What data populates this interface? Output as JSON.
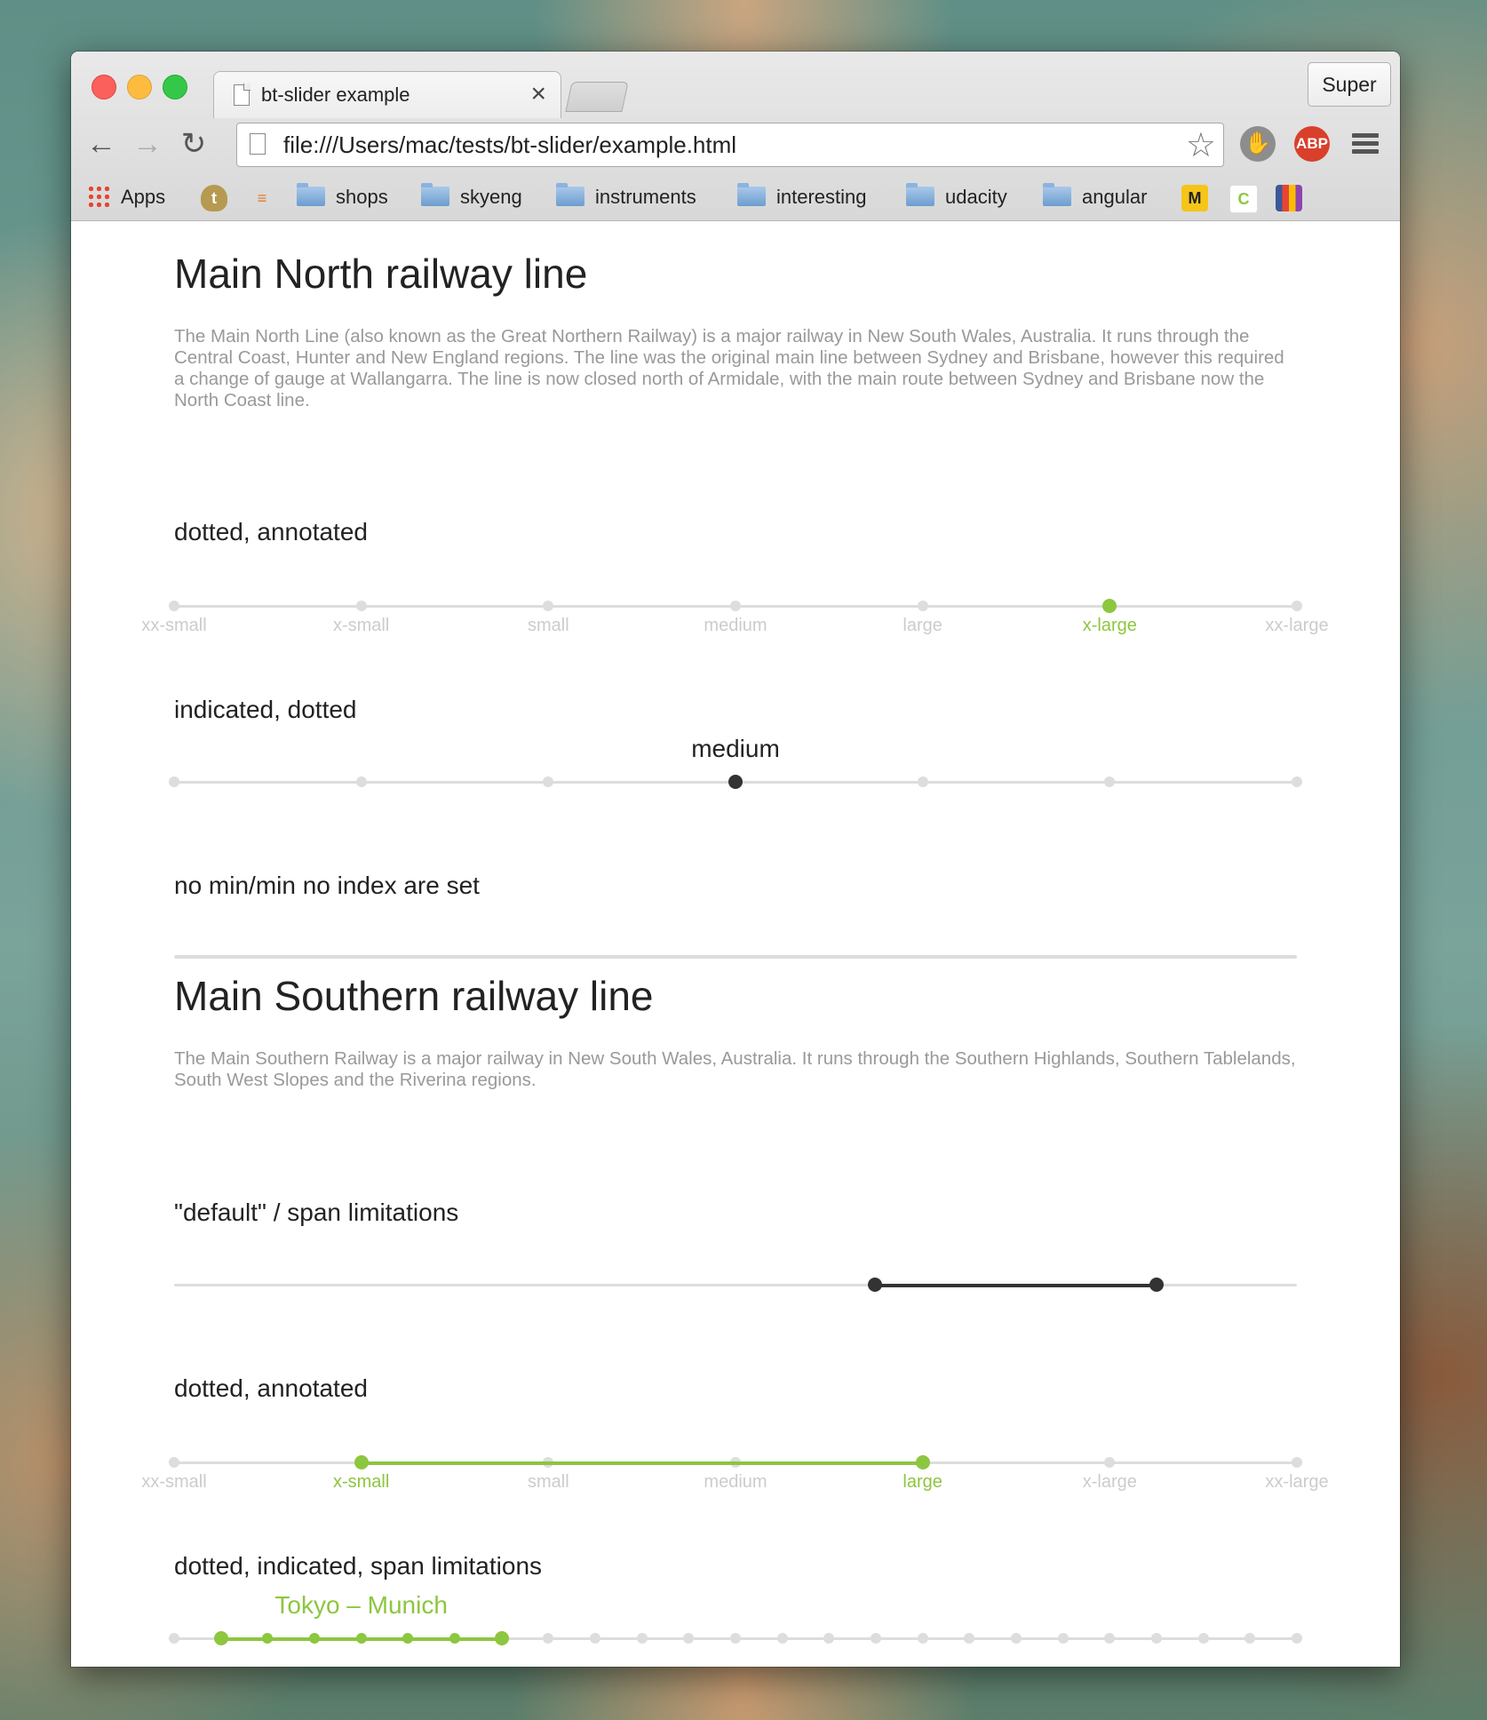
{
  "browser": {
    "tab_title": "bt-slider example",
    "tab_close": "×",
    "profile_label": "Super",
    "url": "file:///Users/mac/tests/bt-slider/example.html",
    "bookmarks": {
      "apps": "Apps",
      "folders": [
        "shops",
        "skyeng",
        "instruments",
        "interesting",
        "udacity",
        "angular"
      ],
      "m_icon": "M"
    },
    "abp_label": "ABP"
  },
  "colors": {
    "accent": "#8dc63f",
    "handle": "#333333",
    "track": "#dddddd"
  },
  "north": {
    "title": "Main North railway line",
    "description": "The Main North Line (also known as the Great Northern Railway) is a major railway in New South Wales, Australia. It runs through the Central Coast, Hunter and New England regions. The line was the original main line between Sydney and Brisbane, however this required a change of gauge at Wallangarra. The line is now closed north of Armidale, with the main route between Sydney and Brisbane now the North Coast line.",
    "slider1": {
      "label": "dotted, annotated",
      "ticks": [
        "xx-small",
        "x-small",
        "small",
        "medium",
        "large",
        "x-large",
        "xx-large"
      ],
      "selected_index": 5
    },
    "slider2": {
      "label": "indicated, dotted",
      "indicator": "medium",
      "selected_index": 3,
      "tick_count": 7
    },
    "slider3": {
      "label": "no min/min no index are set"
    }
  },
  "south": {
    "title": "Main Southern railway line",
    "description": "The Main Southern Railway is a major railway in New South Wales, Australia. It runs through the Southern Highlands, Southern Tablelands, South West Slopes and the Riverina regions.",
    "slider1": {
      "label": "\"default\" / span limitations",
      "range": [
        0.624,
        0.875
      ]
    },
    "slider2": {
      "label": "dotted, annotated",
      "ticks": [
        "xx-small",
        "x-small",
        "small",
        "medium",
        "large",
        "x-large",
        "xx-large"
      ],
      "range_index": [
        1,
        4
      ]
    },
    "slider3": {
      "label": "dotted, indicated, span limitations",
      "indicator": "Tokyo – Munich",
      "tick_count": 25,
      "range_index": [
        1,
        7
      ]
    },
    "buttons": [
      "id",
      "disabled"
    ]
  }
}
